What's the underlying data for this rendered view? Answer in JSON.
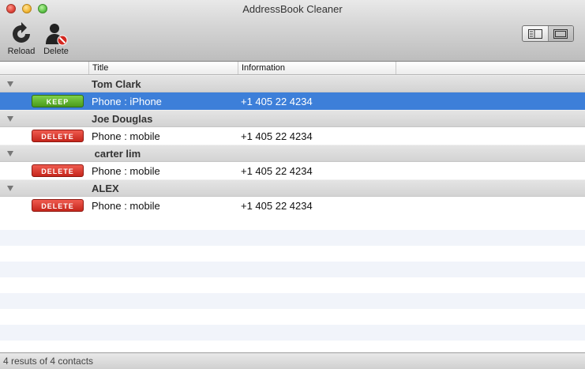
{
  "window": {
    "title": "AddressBook Cleaner"
  },
  "toolbar": {
    "reload_label": "Reload",
    "delete_label": "Delete"
  },
  "columns": {
    "title": "Title",
    "information": "Information"
  },
  "groups": [
    {
      "name": "Tom Clark",
      "item": {
        "action": "KEEP",
        "title": "Phone : iPhone",
        "information": "+1 405 22 4234",
        "selected": true
      }
    },
    {
      "name": "Joe Douglas",
      "item": {
        "action": "DELETE",
        "title": "Phone : mobile",
        "information": "+1 405 22 4234",
        "selected": false
      }
    },
    {
      "name": " carter lim",
      "item": {
        "action": "DELETE",
        "title": "Phone : mobile",
        "information": "+1 405 22 4234",
        "selected": false
      }
    },
    {
      "name": "ALEX",
      "item": {
        "action": "DELETE",
        "title": "Phone : mobile",
        "information": "+1 405 22 4234",
        "selected": false
      }
    }
  ],
  "status": {
    "text": "4 resuts of 4 contacts"
  },
  "colors": {
    "selection": "#3d7fd9",
    "keep": "#4a9a1b",
    "delete": "#c5261c"
  },
  "icons": {
    "reload": "reload-icon",
    "delete": "delete-contact-icon",
    "view_list": "list-view-icon",
    "view_single": "single-view-icon"
  }
}
